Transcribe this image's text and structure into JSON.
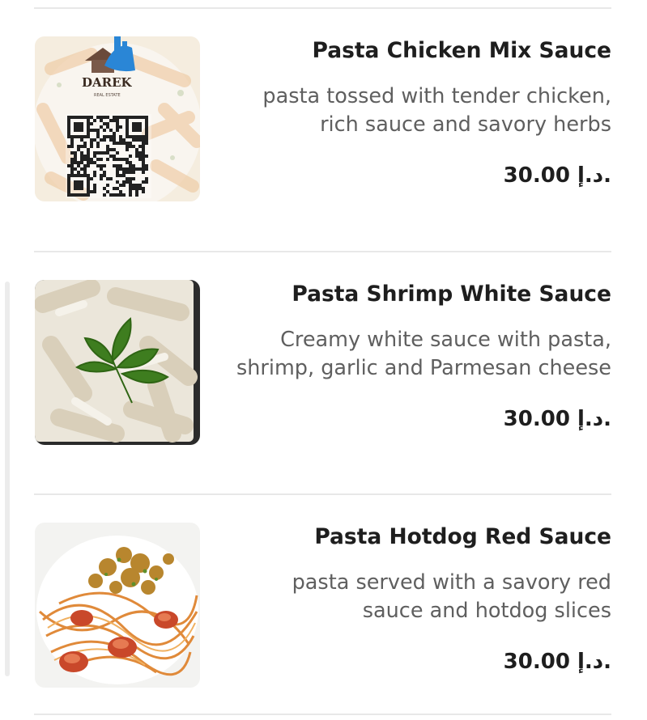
{
  "items": [
    {
      "name": "Pasta Chicken Mix Sauce",
      "description": "pasta tossed with tender chicken, rich sauce and savory herbs",
      "price": "30.00 د.إ.",
      "image_overlay": {
        "brand": "DAREK",
        "tagline": "REAL ESTATE"
      }
    },
    {
      "name": "Pasta Shrimp White Sauce",
      "description": "Creamy white sauce with pasta, shrimp, garlic and Parmesan cheese",
      "price": "30.00 د.إ."
    },
    {
      "name": "Pasta Hotdog Red Sauce",
      "description": "pasta served with a savory red sauce and hotdog slices",
      "price": "30.00 د.إ."
    }
  ]
}
